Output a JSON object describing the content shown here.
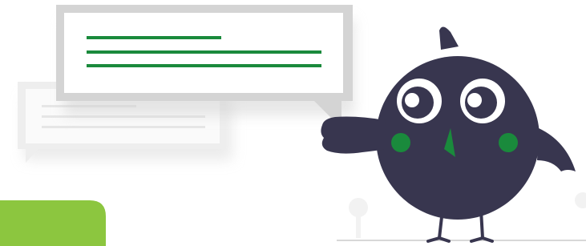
{
  "scene": {
    "background": "#ffffff",
    "colors": {
      "bird_body": "#38364f",
      "cheek": "#1a8a3c",
      "beak": "#1a8a3c",
      "bubble_frame": "#d4d4d4",
      "bubble_fill": "#ffffff",
      "text_line": "#1a8a3c",
      "faint_line": "#e8e8e8",
      "green_block": "#8cc63f",
      "floor": "#cccccc"
    },
    "speech_bubble": {
      "text_lines": 3,
      "icon": "speech-bubble-icon"
    },
    "secondary_bubble": {
      "text_lines": 2,
      "icon": "speech-bubble-icon"
    },
    "mascot": {
      "icon": "bird-mascot-icon"
    },
    "accent_block": {
      "icon": "green-rounded-block"
    }
  }
}
